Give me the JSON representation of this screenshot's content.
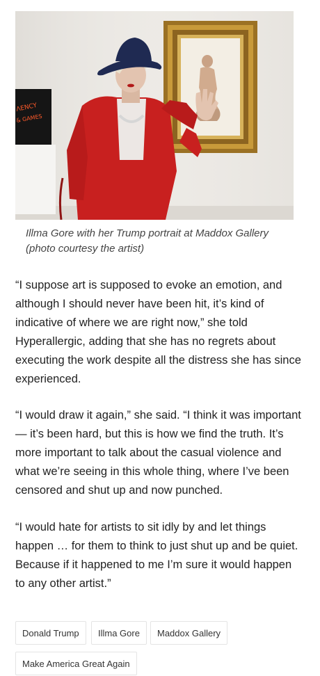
{
  "figure": {
    "neon_text_line1": "ΛENCY",
    "neon_text_line2": "& GAMES",
    "caption_line1": "Illma Gore with her Trump portrait at Maddox Gallery",
    "caption_line2": "(photo courtesy the artist)"
  },
  "article": {
    "paragraph1": [
      "“I suppose art is supposed to evoke an emotion, and",
      "although I should never have been hit, it’s kind of",
      "indicative of where we are right now,” she told",
      "Hyperallergic, adding that she has no regrets about",
      "executing the work despite all the distress she has since",
      "experienced."
    ],
    "paragraph2": [
      "“I would draw it again,” she said. “I think it was important",
      "— it’s been hard, but this is how we find the truth. It’s",
      "more important to talk about the casual violence and",
      "what we’re seeing in this whole thing, where I’ve been",
      "censored and shut up and now punched."
    ],
    "paragraph3": [
      "“I would hate for artists to sit idly by and let things",
      "happen … for them to think to just shut up and be quiet.",
      "Because if it happened to me I’m sure it would happen",
      "to any other artist.”"
    ]
  },
  "tags": [
    "Donald Trump",
    "Illma Gore",
    "Maddox Gallery",
    "Make America Great Again"
  ],
  "colors": {
    "coat": "#c8201f",
    "hat": "#1f2a52",
    "frame_gold": "#b88a2e",
    "wall": "#ece9e4",
    "neon": "#ff5a2a"
  }
}
